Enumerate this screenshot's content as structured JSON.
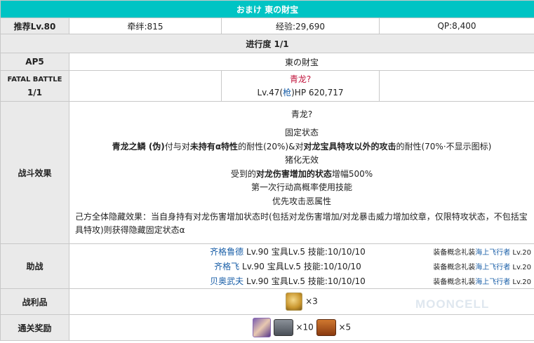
{
  "header": {
    "title": "おまけ 東の財宝"
  },
  "row_rewards": {
    "label": "推荐Lv.80",
    "bond": "牵绊:815",
    "exp": "经验:29,690",
    "qp": "QP:8,400"
  },
  "progress": {
    "label": "进行度 1/1"
  },
  "ap_row": {
    "label": "AP5",
    "quest_name": "東の財宝"
  },
  "fatal": {
    "label_line1": "FATAL BATTLE",
    "label_line2": "1/1",
    "enemy_name": "青龙?",
    "enemy_stats_prefix": "Lv.47(",
    "enemy_class": "枪",
    "enemy_stats_suffix": ")HP 620,717"
  },
  "effects": {
    "label": "战斗效果",
    "name": "青龙?",
    "line1": "固定状态",
    "line2_a": "青龙之鳞 (伪)",
    "line2_b": "付与对",
    "line2_c": "未持有α特性",
    "line2_d": "的耐性(20%)&对",
    "line2_e": "对龙宝具特攻以外的攻击",
    "line2_f": "的耐性(70%·不显示图标)",
    "line3": "猪化无效",
    "line4_a": "受到的",
    "line4_b": "对龙伤害增加的状态",
    "line4_c": "增幅500%",
    "line5": "第一次行动高概率使用技能",
    "line6": "优先攻击恶属性",
    "note": "己方全体隐藏效果：当自身持有对龙伤害增加状态时(包括对龙伤害增加/对龙暴击威力增加纹章，仅限特攻状态，不包括宝具特攻)则获得隐藏固定状态α"
  },
  "support": {
    "label": "助战",
    "rows": [
      {
        "name": "齐格鲁德",
        "stats": " Lv.90 宝具Lv.5 技能:10/10/10",
        "ce_prefix": "装备概念礼装",
        "ce_name": "海上飞行者",
        "ce_lv": " Lv.20"
      },
      {
        "name": "齐格飞",
        "stats": " Lv.90 宝具Lv.5 技能:10/10/10",
        "ce_prefix": "装备概念礼装",
        "ce_name": "海上飞行者",
        "ce_lv": " Lv.20"
      },
      {
        "name": "贝奥武夫",
        "stats": " Lv.90 宝具Lv.5 技能:10/10/10",
        "ce_prefix": "装备概念礼装",
        "ce_name": "海上飞行者",
        "ce_lv": " Lv.20"
      }
    ]
  },
  "drops": {
    "label": "战利品",
    "item_icon": "golden-egg-icon",
    "count": "×3"
  },
  "clear_reward": {
    "label": "通关奖励",
    "portrait_icon": "servant-portrait-icon",
    "silver_chest_icon": "silver-chest-icon",
    "silver_count": "×10",
    "gold_chest_icon": "bronze-chest-icon",
    "gold_count": "×5"
  },
  "watermark": "MOONCELL",
  "colors": {
    "header_bg": "#00c4c4",
    "label_bg": "#eaeaea",
    "enemy_red": "#c0143c",
    "link_blue": "#1a5fa8"
  }
}
